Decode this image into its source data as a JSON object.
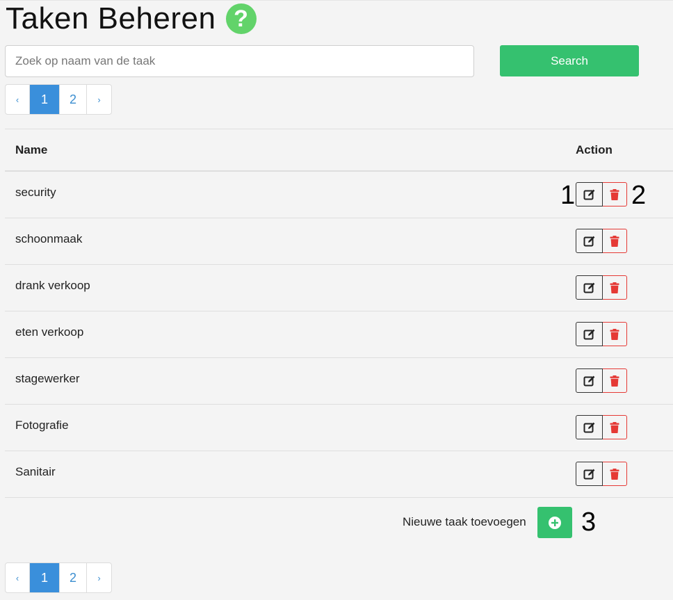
{
  "page": {
    "title": "Taken Beheren",
    "help_icon": "question-circle-icon"
  },
  "search": {
    "placeholder": "Zoek op naam van de taak",
    "value": "",
    "button_label": "Search"
  },
  "pagination": {
    "prev": "‹",
    "next": "›",
    "pages": [
      "1",
      "2"
    ],
    "active_page": "1"
  },
  "table": {
    "headers": {
      "name": "Name",
      "action": "Action"
    },
    "rows": [
      {
        "name": "security"
      },
      {
        "name": "schoonmaak"
      },
      {
        "name": "drank verkoop"
      },
      {
        "name": "eten verkoop"
      },
      {
        "name": "stagewerker"
      },
      {
        "name": "Fotografie"
      },
      {
        "name": "Sanitair"
      }
    ],
    "edit_icon": "edit-icon",
    "delete_icon": "trash-icon"
  },
  "add_task": {
    "label": "Nieuwe taak toevoegen",
    "icon": "plus-circle-icon"
  },
  "annotations": [
    "1",
    "2",
    "3"
  ],
  "colors": {
    "primary_green": "#35c16f",
    "help_green": "#62d36a",
    "active_page_blue": "#3a8fdb",
    "delete_red": "#e53935"
  }
}
